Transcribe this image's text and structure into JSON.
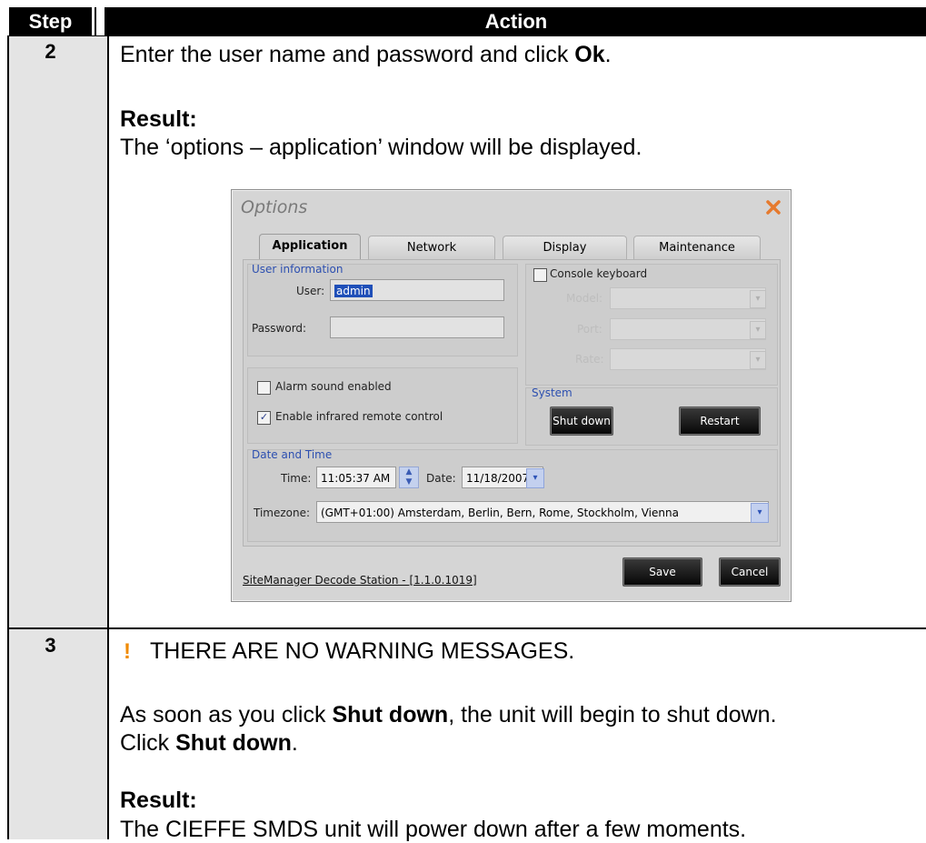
{
  "table": {
    "header": {
      "step": "Step",
      "action": "Action"
    },
    "rows": [
      {
        "step": "2",
        "line1_pre": "Enter the user name and password and click ",
        "line1_bold": "Ok",
        "line1_post": ".",
        "result_label": "Result:",
        "result_text": "The ‘options – application’ window will be displayed."
      },
      {
        "step": "3",
        "warning_symbol": "!",
        "warning_text": "THERE ARE NO WARNING MESSAGES.",
        "line_a_pre": "As soon as you click ",
        "line_a_bold": "Shut down",
        "line_a_post": ", the unit will begin to shut down.",
        "line_b_pre": "Click ",
        "line_b_bold": "Shut down",
        "line_b_post": ".",
        "result_label": "Result:",
        "result_text": "The CIEFFE SMDS unit will power down after a few moments."
      }
    ]
  },
  "dialog": {
    "title": "Options",
    "close_icon": "close-icon",
    "tabs": [
      "Application",
      "Network",
      "Display",
      "Maintenance"
    ],
    "active_tab": "Application",
    "user_info": {
      "group_label": "User information",
      "user_label": "User:",
      "user_value": "admin",
      "password_label": "Password:",
      "password_value": ""
    },
    "options": {
      "alarm_label": "Alarm sound enabled",
      "alarm_checked": false,
      "infrared_label": "Enable infrared remote control",
      "infrared_checked": true
    },
    "console": {
      "label": "Console keyboard",
      "checked": false,
      "model_label": "Model:",
      "port_label": "Port:",
      "rate_label": "Rate:"
    },
    "system": {
      "group_label": "System",
      "shutdown_label": "Shut down",
      "restart_label": "Restart"
    },
    "datetime": {
      "group_label": "Date and Time",
      "time_label": "Time:",
      "time_value": "11:05:37 AM",
      "date_label": "Date:",
      "date_value": "11/18/2007",
      "timezone_label": "Timezone:",
      "timezone_value": "(GMT+01:00) Amsterdam, Berlin, Bern, Rome, Stockholm, Vienna"
    },
    "footer": {
      "version_text": "SiteManager Decode Station -  [1.1.0.1019]",
      "save_label": "Save",
      "cancel_label": "Cancel"
    }
  }
}
